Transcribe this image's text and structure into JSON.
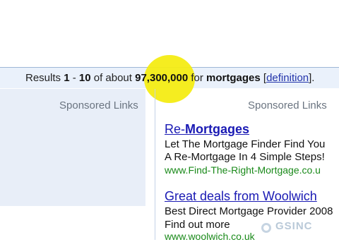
{
  "results": {
    "prefix": "Results ",
    "range_start": "1",
    "dash": " - ",
    "range_end": "10",
    "of_about": " of about ",
    "total": "97,300,000",
    "for": " for ",
    "query": "mortgages",
    "definition_open": " [",
    "definition": "definition",
    "definition_close": "].",
    "trailing": " ."
  },
  "sponsored": {
    "left_label": "Sponsored Links",
    "right_label": "Sponsored Links"
  },
  "ads": [
    {
      "title_prefix": "Re-",
      "title_bold": "Mortgages",
      "line1": "Let The Mortgage Finder Find You",
      "line2": "A Re-Mortgage In 4 Simple Steps!",
      "url": "www.Find-The-Right-Mortgage.co.u"
    },
    {
      "title": "Great deals from Woolwich",
      "line1": "Best Direct Mortgage Provider 2008",
      "line2": "Find out more",
      "url": "www.woolwich.co.uk"
    }
  ],
  "watermark": {
    "text": "GSINC",
    "icon": "gsinc-logo-icon"
  }
}
